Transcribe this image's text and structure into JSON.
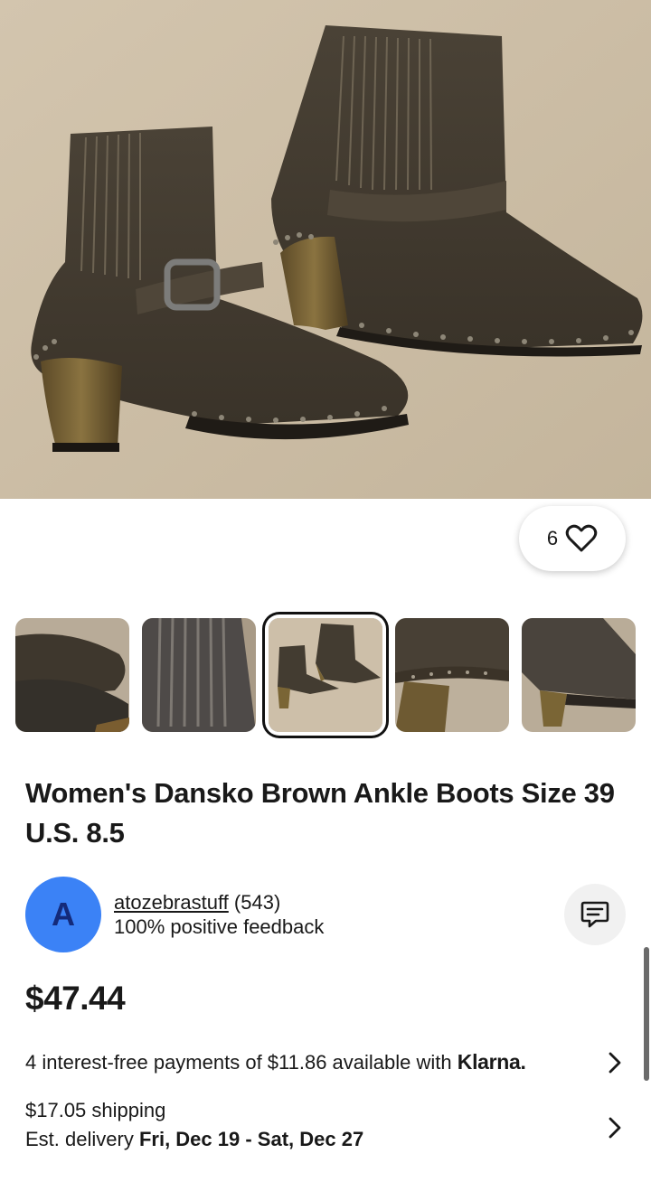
{
  "hero": {
    "image": "brown-ankle-boots-photo",
    "favorite_count": "6"
  },
  "thumbnails": [
    {
      "name": "boot-toe-closeup",
      "selected": false
    },
    {
      "name": "boot-elastic-panel",
      "selected": false
    },
    {
      "name": "boots-pair",
      "selected": true
    },
    {
      "name": "boot-studded-sole",
      "selected": false
    },
    {
      "name": "boot-heel-side",
      "selected": false
    }
  ],
  "listing": {
    "title": "Women's Dansko Brown Ankle Boots Size 39 U.S. 8.5",
    "price": "$47.44"
  },
  "seller": {
    "avatar_letter": "A",
    "username": "atozebrastuff",
    "score": "(543)",
    "feedback": "100% positive feedback"
  },
  "payments": {
    "text": "4 interest-free payments of $11.86 available with",
    "provider": "Klarna."
  },
  "shipping": {
    "cost": "$17.05 shipping",
    "delivery_label": "Est. delivery",
    "delivery_dates": "Fri, Dec 19 - Sat, Dec 27"
  },
  "colors": {
    "avatar_bg": "#3b82f6",
    "text": "#191919"
  }
}
